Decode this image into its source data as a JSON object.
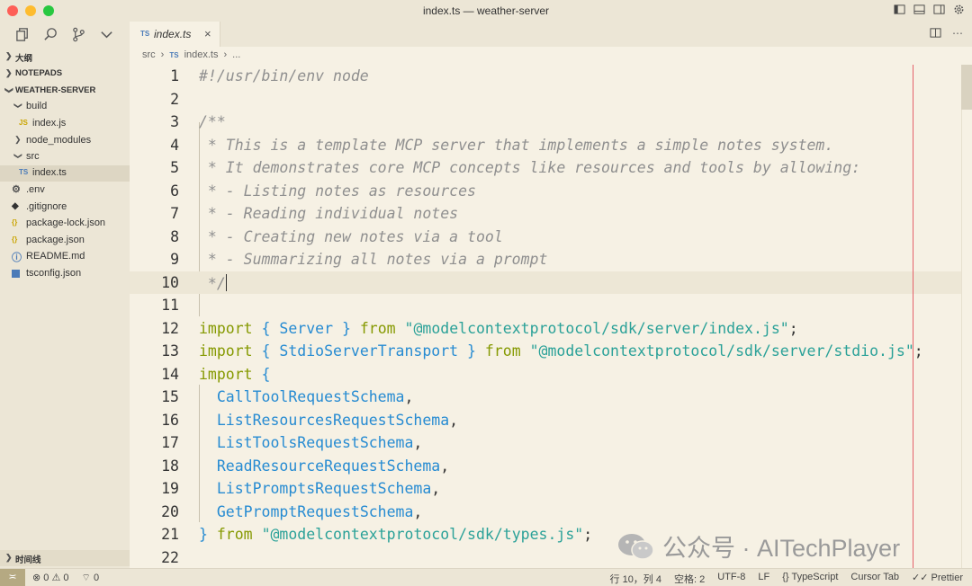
{
  "window": {
    "title": "index.ts — weather-server"
  },
  "sidebar": {
    "outline_section": "大纲",
    "notepads_section": "NOTEPADS",
    "project_section": "WEATHER-SERVER",
    "timeline_section": "时间线",
    "items": [
      {
        "label": "build",
        "kind": "folder-open"
      },
      {
        "label": "index.js",
        "kind": "js"
      },
      {
        "label": "node_modules",
        "kind": "folder-closed"
      },
      {
        "label": "src",
        "kind": "folder-open"
      },
      {
        "label": "index.ts",
        "kind": "ts"
      },
      {
        "label": ".env",
        "kind": "gear"
      },
      {
        "label": ".gitignore",
        "kind": "git"
      },
      {
        "label": "package-lock.json",
        "kind": "json"
      },
      {
        "label": "package.json",
        "kind": "json"
      },
      {
        "label": "README.md",
        "kind": "info"
      },
      {
        "label": "tsconfig.json",
        "kind": "ts-config"
      }
    ]
  },
  "tab": {
    "badge": "TS",
    "name": "index.ts",
    "close": "×"
  },
  "breadcrumb": {
    "src": "src",
    "badge": "TS",
    "file": "index.ts",
    "more": "..."
  },
  "code": {
    "l1": "#!/usr/bin/env node",
    "l3": "/**",
    "l4": " * This is a template MCP server that implements a simple notes system.",
    "l5": " * It demonstrates core MCP concepts like resources and tools by allowing:",
    "l6": " * - Listing notes as resources",
    "l7": " * - Reading individual notes",
    "l8": " * - Creating new notes via a tool",
    "l9": " * - Summarizing all notes via a prompt",
    "l10": " */",
    "import": "import",
    "from": "from",
    "l12_ident": "Server",
    "l12_str": "\"@modelcontextprotocol/sdk/server/index.js\"",
    "l13_ident": "StdioServerTransport",
    "l13_str": "\"@modelcontextprotocol/sdk/server/stdio.js\"",
    "l15": "CallToolRequestSchema",
    "l16": "ListResourcesRequestSchema",
    "l17": "ListToolsRequestSchema",
    "l18": "ReadResourceRequestSchema",
    "l19": "ListPromptsRequestSchema",
    "l20": "GetPromptRequestSchema",
    "l21_str": "\"@modelcontextprotocol/sdk/types.js\""
  },
  "watermark": {
    "text": "公众号 · AITechPlayer"
  },
  "status": {
    "errors": "0",
    "warnings": "0",
    "ports": "0",
    "position": "行 10，列 4",
    "spaces": "空格: 2",
    "encoding": "UTF-8",
    "eol": "LF",
    "language": "TypeScript",
    "cursor_tab": "Cursor Tab",
    "prettier": "Prettier"
  }
}
